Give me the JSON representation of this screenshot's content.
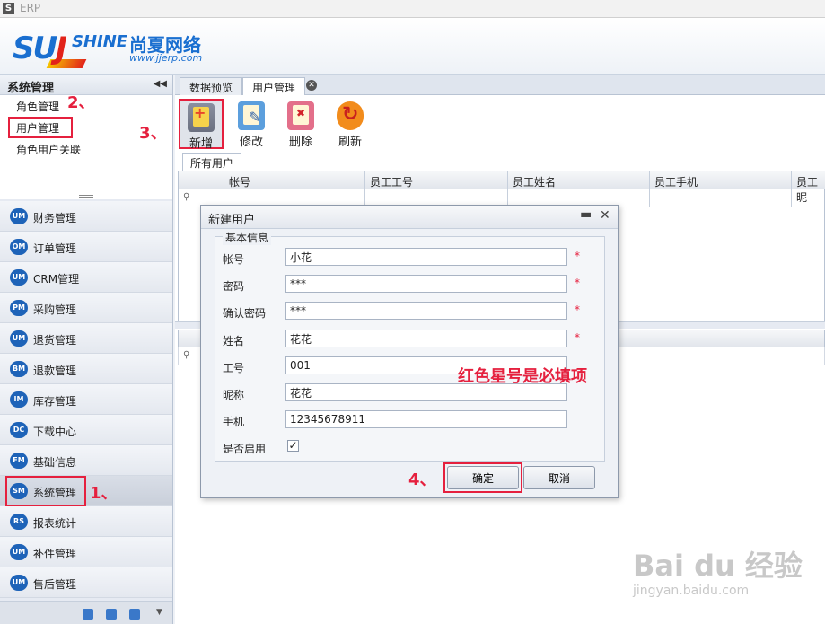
{
  "window": {
    "app_icon": "S",
    "title": "ERP"
  },
  "header": {
    "logo_mark": "SUNSHINE",
    "logo_cn": "尚夏网络",
    "logo_url": "www.jjerp.com"
  },
  "sidebar": {
    "title": "系统管理",
    "sub_items": [
      "角色管理",
      "用户管理",
      "角色用户关联"
    ],
    "nav": [
      {
        "icon": "UM",
        "label": "财务管理"
      },
      {
        "icon": "OM",
        "label": "订单管理"
      },
      {
        "icon": "UM",
        "label": "CRM管理"
      },
      {
        "icon": "PM",
        "label": "采购管理"
      },
      {
        "icon": "UM",
        "label": "退货管理"
      },
      {
        "icon": "BM",
        "label": "退款管理"
      },
      {
        "icon": "IM",
        "label": "库存管理"
      },
      {
        "icon": "DC",
        "label": "下载中心"
      },
      {
        "icon": "FM",
        "label": "基础信息"
      },
      {
        "icon": "SM",
        "label": "系统管理"
      },
      {
        "icon": "RS",
        "label": "报表统计"
      },
      {
        "icon": "UM",
        "label": "补件管理"
      },
      {
        "icon": "UM",
        "label": "售后管理"
      }
    ]
  },
  "tabs": [
    "数据预览",
    "用户管理"
  ],
  "toolbar": {
    "add": "新增",
    "edit": "修改",
    "delete": "删除",
    "refresh": "刷新"
  },
  "subtab": "所有用户",
  "grid": {
    "columns": [
      "帐号",
      "员工工号",
      "员工姓名",
      "员工手机",
      "员工昵"
    ]
  },
  "dialog": {
    "title": "新建用户",
    "group": "基本信息",
    "fields": [
      {
        "label": "帐号",
        "value": "小花",
        "required": "*"
      },
      {
        "label": "密码",
        "value": "***",
        "required": "*"
      },
      {
        "label": "确认密码",
        "value": "***",
        "required": "*"
      },
      {
        "label": "姓名",
        "value": "花花",
        "required": "*"
      },
      {
        "label": "工号",
        "value": "001",
        "required": ""
      },
      {
        "label": "昵称",
        "value": "花花",
        "required": ""
      },
      {
        "label": "手机",
        "value": "12345678911",
        "required": ""
      }
    ],
    "enable_label": "是否启用",
    "ok": "确定",
    "cancel": "取消"
  },
  "annotations": {
    "step1": "1、",
    "step2": "2、",
    "step3": "3、",
    "step4": "4、",
    "note": "红色星号是必填项"
  },
  "watermark": {
    "brand": "Bai du 经验",
    "sub": "jingyan.baidu.com"
  },
  "colors": {
    "accent": "#e5203e",
    "nav_icon": "#1e63b8"
  }
}
